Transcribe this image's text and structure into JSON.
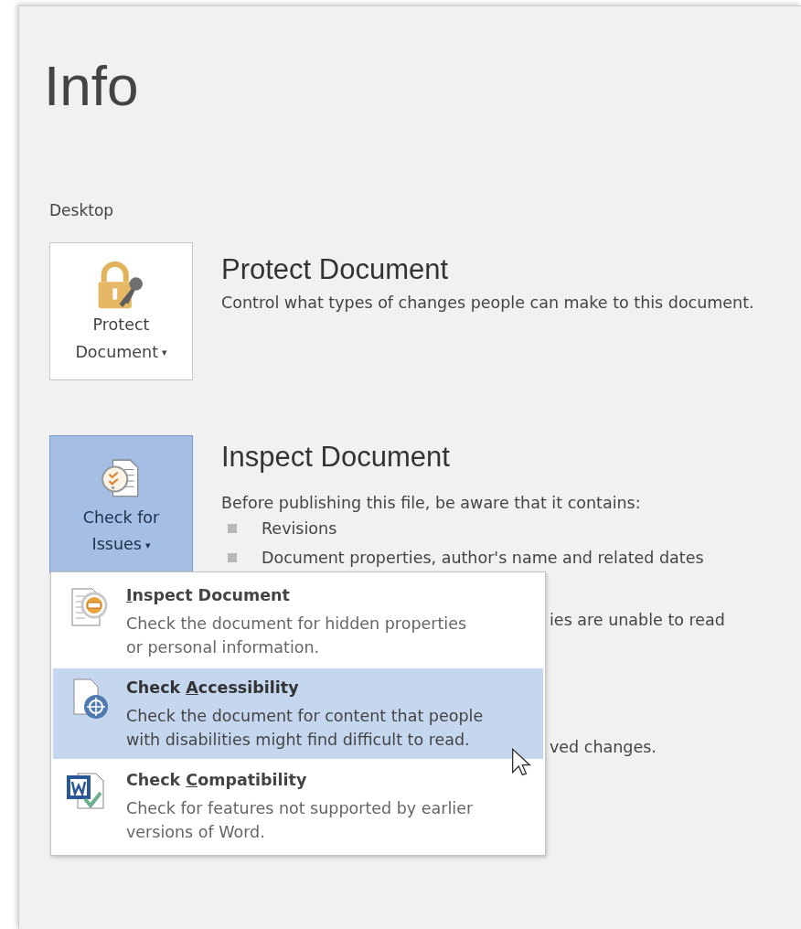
{
  "page_title": "Info",
  "section_label": "Desktop",
  "protect": {
    "button": [
      "Protect",
      "Document"
    ],
    "caret": "▾",
    "selected": false,
    "heading": "Protect Document",
    "description": "Control what types of changes people can make to this document."
  },
  "inspect": {
    "button": [
      "Check for",
      "Issues"
    ],
    "caret": "▾",
    "selected": true,
    "heading": "Inspect Document",
    "description": "Before publishing this file, be aware that it contains:",
    "bullets": [
      "Revisions",
      "Document properties, author's name and related dates"
    ],
    "hidden_fragments": [
      "ies are unable to read",
      "ved changes."
    ]
  },
  "menu": [
    {
      "kind": "inspect",
      "title": [
        {
          "text": "I",
          "underline": true
        },
        {
          "text": "nspect Document",
          "underline": false
        }
      ],
      "description": [
        "Check the document for hidden properties",
        "or personal information."
      ],
      "selected": false
    },
    {
      "kind": "accessibility",
      "title": [
        {
          "text": "Check ",
          "underline": false
        },
        {
          "text": "A",
          "underline": true
        },
        {
          "text": "ccessibility",
          "underline": false
        }
      ],
      "description": [
        "Check the document for content that people",
        "with disabilities might find difficult to read."
      ],
      "selected": true
    },
    {
      "kind": "compatibility",
      "title": [
        {
          "text": "Check ",
          "underline": false
        },
        {
          "text": "C",
          "underline": true
        },
        {
          "text": "ompatibility",
          "underline": false
        }
      ],
      "description": [
        "Check for features not supported by earlier",
        "versions of Word."
      ],
      "selected": false
    }
  ]
}
